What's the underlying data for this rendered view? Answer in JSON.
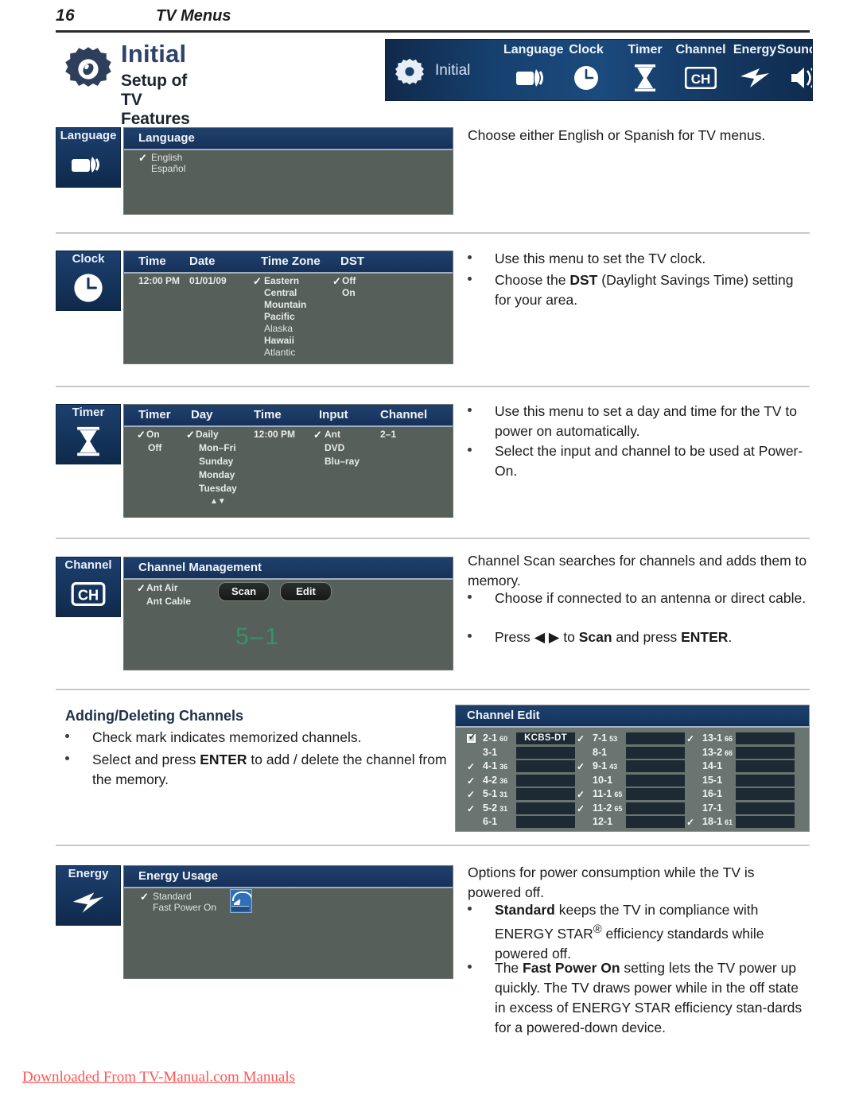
{
  "header": {
    "page_number": "16",
    "title": "TV Menus"
  },
  "title_block": {
    "icon": "gear-icon",
    "main": "Initial",
    "sub": "Setup of TV Features"
  },
  "osd_menubar": {
    "gear_icon": "gear-icon",
    "current": "Initial",
    "items": [
      {
        "label": "Language",
        "icon": "speech-camera-icon"
      },
      {
        "label": "Clock",
        "icon": "clock-icon"
      },
      {
        "label": "Timer",
        "icon": "hourglass-icon"
      },
      {
        "label": "Channel",
        "icon": "ch-icon"
      },
      {
        "label": "Energy",
        "icon": "lightning-bolt-icon"
      },
      {
        "label": "SoundPro",
        "icon": "speaker-icon"
      }
    ]
  },
  "sections": {
    "language": {
      "tag": {
        "label": "Language",
        "icon": "speech-camera-icon"
      },
      "panel_title": "Language",
      "options": [
        {
          "label": "English",
          "checked": true
        },
        {
          "label": "Español",
          "checked": false
        }
      ],
      "description": "Choose either English or Spanish for TV menus."
    },
    "clock": {
      "tag": {
        "label": "Clock",
        "icon": "clock-icon"
      },
      "columns": [
        "Time",
        "Date",
        "Time Zone",
        "DST"
      ],
      "time_value": "12:00 PM",
      "date_value": "01/01/09",
      "time_zones": [
        {
          "label": "Eastern",
          "checked": true
        },
        {
          "label": "Central",
          "checked": false
        },
        {
          "label": "Mountain",
          "checked": false
        },
        {
          "label": "Pacific",
          "checked": false
        },
        {
          "label": "Alaska",
          "checked": false
        },
        {
          "label": "Hawaii",
          "checked": false
        },
        {
          "label": "Atlantic",
          "checked": false
        }
      ],
      "dst": [
        {
          "label": "Off",
          "checked": true
        },
        {
          "label": "On",
          "checked": false
        }
      ],
      "bullets": [
        "Use this menu to set the TV clock.",
        "Choose the <b>DST</b> (Daylight Savings Time) setting for your area."
      ]
    },
    "timer": {
      "tag": {
        "label": "Timer",
        "icon": "hourglass-icon"
      },
      "columns": [
        "Timer",
        "Day",
        "Time",
        "Input",
        "Channel"
      ],
      "timer_options": [
        {
          "label": "On",
          "checked": true
        },
        {
          "label": "Off",
          "checked": false
        }
      ],
      "day_options": [
        {
          "label": "Daily",
          "checked": true
        },
        {
          "label": "Mon–Fri",
          "checked": false
        },
        {
          "label": "Sunday",
          "checked": false
        },
        {
          "label": "Monday",
          "checked": false
        },
        {
          "label": "Tuesday",
          "checked": false
        }
      ],
      "day_scroll": "▲▼",
      "time_value": "12:00 PM",
      "input_options": [
        {
          "label": "Ant",
          "checked": true
        },
        {
          "label": "DVD",
          "checked": false
        },
        {
          "label": "Blu–ray",
          "checked": false
        }
      ],
      "channel_value": "2–1",
      "bullets": [
        "Use this menu to set a day and time for the TV to power on automatically.",
        "Select the input and channel to be used at Power-On."
      ]
    },
    "channel": {
      "tag": {
        "label": "Channel",
        "icon": "ch-icon"
      },
      "panel_title": "Channel Management",
      "options": [
        {
          "label": "Ant Air",
          "checked": true
        },
        {
          "label": "Ant Cable",
          "checked": false
        }
      ],
      "buttons": [
        "Scan",
        "Edit"
      ],
      "scan_display": "5–1",
      "intro": "Channel Scan searches for channels and adds them to memory.",
      "bullets": [
        "Choose if connected to an antenna or direct cable.",
        "Press ◀ ▶ to <b>Scan</b> and press <b>ENTER</b>."
      ]
    },
    "adding_deleting": {
      "heading": "Adding/Deleting Channels",
      "bullets": [
        "Check mark indicates memorized channels.",
        "Select and press <b>ENTER</b> to add / delete the channel from the memory."
      ]
    },
    "channel_edit": {
      "panel_title": "Channel Edit",
      "columns": [
        {
          "rows": [
            {
              "num": "2-1",
              "sub": "60",
              "mark": "box",
              "name": "KCBS-DT"
            },
            {
              "num": "3-1",
              "sub": "",
              "mark": "none",
              "name": ""
            },
            {
              "num": "4-1",
              "sub": "36",
              "mark": "check",
              "name": ""
            },
            {
              "num": "4-2",
              "sub": "36",
              "mark": "check",
              "name": ""
            },
            {
              "num": "5-1",
              "sub": "31",
              "mark": "check",
              "name": ""
            },
            {
              "num": "5-2",
              "sub": "31",
              "mark": "check",
              "name": ""
            },
            {
              "num": "6-1",
              "sub": "",
              "mark": "none",
              "name": ""
            }
          ]
        },
        {
          "rows": [
            {
              "num": "7-1",
              "sub": "53",
              "mark": "check",
              "name": ""
            },
            {
              "num": "8-1",
              "sub": "",
              "mark": "none",
              "name": ""
            },
            {
              "num": "9-1",
              "sub": "43",
              "mark": "check",
              "name": ""
            },
            {
              "num": "10-1",
              "sub": "",
              "mark": "none",
              "name": ""
            },
            {
              "num": "11-1",
              "sub": "65",
              "mark": "check",
              "name": ""
            },
            {
              "num": "11-2",
              "sub": "65",
              "mark": "check",
              "name": ""
            },
            {
              "num": "12-1",
              "sub": "",
              "mark": "none",
              "name": ""
            }
          ]
        },
        {
          "rows": [
            {
              "num": "13-1",
              "sub": "66",
              "mark": "check",
              "name": ""
            },
            {
              "num": "13-2",
              "sub": "66",
              "mark": "none",
              "name": ""
            },
            {
              "num": "14-1",
              "sub": "",
              "mark": "none",
              "name": ""
            },
            {
              "num": "15-1",
              "sub": "",
              "mark": "none",
              "name": ""
            },
            {
              "num": "16-1",
              "sub": "",
              "mark": "none",
              "name": ""
            },
            {
              "num": "17-1",
              "sub": "",
              "mark": "none",
              "name": ""
            },
            {
              "num": "18-1",
              "sub": "61",
              "mark": "check",
              "name": ""
            }
          ]
        }
      ]
    },
    "energy": {
      "tag": {
        "label": "Energy",
        "icon": "lightning-bolt-icon"
      },
      "panel_title": "Energy Usage",
      "options": [
        {
          "label": "Standard",
          "checked": true
        },
        {
          "label": "Fast Power On",
          "checked": false
        }
      ],
      "logo": "energy-star-logo",
      "intro": "Options for power consumption while the TV is powered off.",
      "bullets": [
        "<b>Standard</b> keeps the TV in compliance with ENERGY STAR<sup>®</sup> efficiency standards while powered off.",
        "The <b>Fast Power On</b> setting lets the TV power up quickly.  The TV draws power while in the off state in excess of ENERGY STAR efficiency stan-dards for a powered-down device."
      ]
    }
  },
  "footer": {
    "text": "Downloaded From TV-Manual.com Manuals"
  },
  "colors": {
    "osd_blue": "#16406e",
    "tag_blue": "#14345c",
    "panel_gray": "#575f5b",
    "title_blue": "#2e4369",
    "scan_green": "#2f9e6a",
    "footer_red": "#ff5555"
  }
}
